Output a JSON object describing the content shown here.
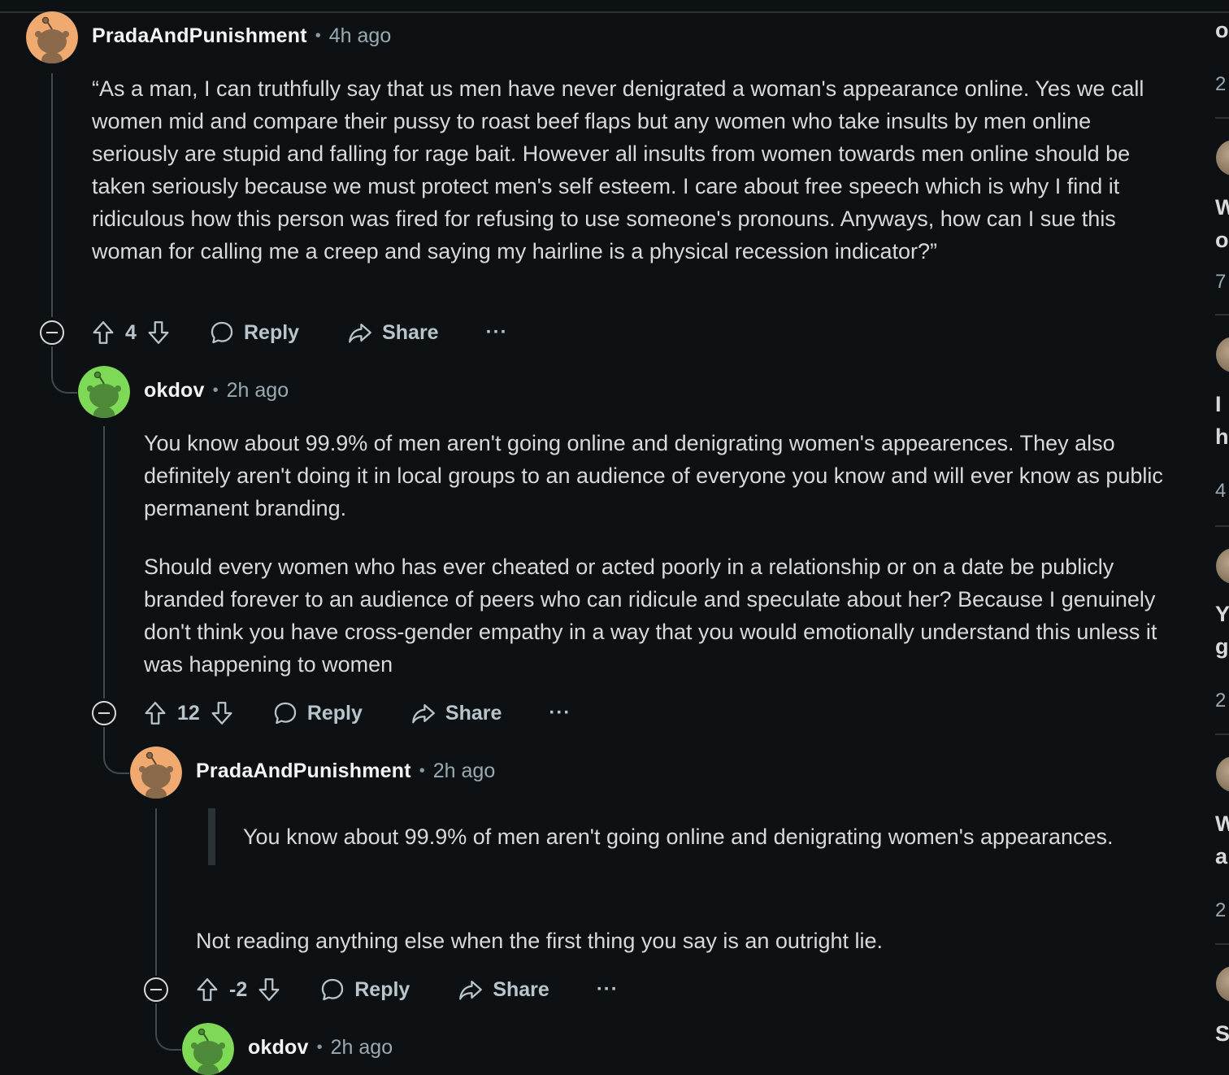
{
  "comments": [
    {
      "username": "PradaAndPunishment",
      "time": "4h ago",
      "avatar": "orange",
      "body": [
        "“As a man, I can truthfully say that us men have never denigrated a woman's appearance online. Yes we call women mid and compare their pussy to roast beef flaps but any women who take insults by men online seriously are stupid and falling for rage bait. However all insults from women towards men online should be taken seriously because we must protect men's self esteem. I care about free speech which is why I find it ridiculous how this person was fired for refusing to use someone's pronouns. Anyways, how can I sue this woman for calling me a creep and saying my hairline is a physical recession indicator?”"
      ],
      "votes": "4"
    },
    {
      "username": "okdov",
      "time": "2h ago",
      "avatar": "green",
      "body": [
        "You know about 99.9% of men aren't going online and denigrating women's appearences. They also definitely aren't doing it in local groups to an audience of everyone you know and will ever know as public permanent branding.",
        "Should every women who has ever cheated or acted poorly in a relationship or on a date be publicly branded forever to an audience of peers who can ridicule and speculate about her? Because I genuinely don't think you have cross-gender empathy in a way that you would emotionally understand this unless it was happening to women"
      ],
      "votes": "12"
    },
    {
      "username": "PradaAndPunishment",
      "time": "2h ago",
      "avatar": "orange",
      "quote": "You know about 99.9% of men aren't going online and denigrating women's appearances.",
      "body": [
        "Not reading anything else when the first thing you say is an outright lie."
      ],
      "votes": "-2"
    },
    {
      "username": "okdov",
      "time": "2h ago",
      "avatar": "green"
    }
  ],
  "actions": {
    "reply": "Reply",
    "share": "Share",
    "more": "···"
  },
  "separator": "•",
  "colors": {
    "background": "#0e1113",
    "text": "#d7dadc",
    "muted": "#9aaab3",
    "thread": "#3e4a50",
    "avatar_orange": "#f0a96e",
    "avatar_green": "#7ed957"
  },
  "sidebar_fragments": [
    "o",
    "2",
    "W",
    "o",
    "7",
    "I",
    "h",
    "4",
    "Y",
    "g",
    "2",
    "W",
    "a",
    "2",
    "S"
  ]
}
